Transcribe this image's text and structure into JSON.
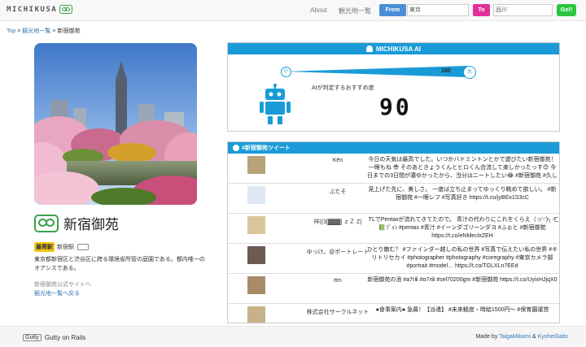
{
  "nav": {
    "brand": "MICHIKUSA",
    "about": "About",
    "spots": "観光地一覧",
    "from_label": "From",
    "from_value": "東京",
    "to_label": "To",
    "to_value": "品川",
    "go_label": "Go!!"
  },
  "breadcrumb": {
    "top": "Top",
    "sep1": ">",
    "spots": "観光地一覧",
    "sep2": ">",
    "current": "新宿御苑"
  },
  "place": {
    "name": "新宿御苑",
    "station_badge": "最寄駅",
    "station": "新宿駅",
    "description": "東京都新宿区と渋谷区に跨る環境省所管の庭園である。都内唯一のオアシスである。",
    "site_link": "新宿御苑公式サイトへ",
    "back_link": "観光地一覧へ戻る"
  },
  "ai": {
    "title": "MICHIKUSA AI",
    "small_label": "小",
    "large_label": "大",
    "bar_max_value": "100",
    "bar_level": 1.0,
    "caption": "AIが判定するおすすめ度",
    "score": "90"
  },
  "tweets": {
    "title": "#新宿御苑ツイート",
    "items": [
      {
        "user": "Kēn",
        "text": "今日の天気は最高でした。いつかバドミントンとかで遊びたい新宿御苑！ 一眼もね 😎 そのあときょうくんとヒロくん合流して楽しかったっす😊 今日までの3日間が濃ゆかったから、当分はニートしたい😂 #新宿御苑 #久しぶり #いつか… https://t.co/erOBTtfpxd"
      },
      {
        "user": "ぶたそ",
        "text": "見上げた先に、美しさ。 一度は立ち止まってゆっくり眺めて欲しい。 #新宿御苑 #一眼レフ #写真好き https://t.co/jyBEx1S3cC"
      },
      {
        "user": "祥((3[▓▓▓] ｚＺ Z)",
        "text": "TLでPentaxが流れてきてたので。 青汁の代わりにこれをくらえ（っ'-')╮ =͟͟͞͞ 📗ﾌﾞｫﾝ #pentax #青汁 #イーンダゴリーンダヨ #ふぉと #新宿御苑 https://t.co/eNMeclxZEH"
      },
      {
        "user": "ゆっけ。@ポートレート",
        "text": "ひとり散む？ #ファインダー越しの私の世界 #写真で伝えたい私の世界 #キリトリセカイ #photographer #photography #coregraphy #東京カメラ部 #portrait #model… https://t.co/TGLXLn7EEd"
      },
      {
        "user": "ttm",
        "text": "新宿御苑の池 #a7rⅲ #α7rⅲ #sel70200gm #新宿御苑 https://t.co/UyixHJjqX0"
      },
      {
        "user": "株式会社サークルネット",
        "text": "●食事案内● 急募！【派遣】 #未来軽度・時給1500円〜 #保育園運営"
      }
    ]
  },
  "footer": {
    "logo": "Gutty",
    "brand": "Gutty on Rails",
    "made_by": "Made by",
    "author1": "TaigaMikami",
    "amp": "&",
    "author2": "KyoheiSaito"
  },
  "colors": {
    "accent": "#1a9bd7",
    "from": "#4a8fd6",
    "to": "#e0309a",
    "go": "#2bc53f",
    "brand_green": "#3aa04a",
    "badge_yellow": "#f5c518",
    "link": "#337ab7"
  }
}
